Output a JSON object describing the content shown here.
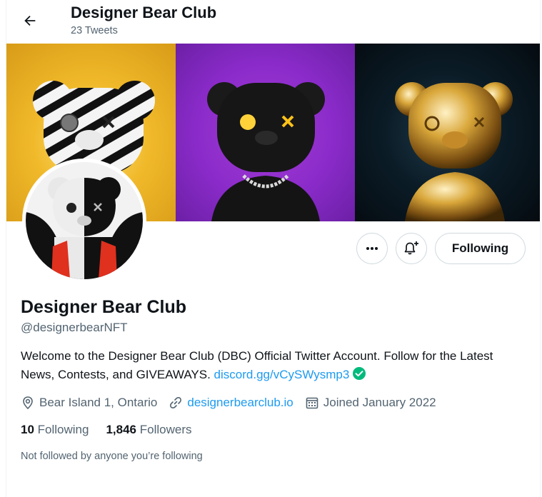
{
  "header": {
    "title": "Designer Bear Club",
    "subtitle": "23 Tweets"
  },
  "actions": {
    "following_label": "Following"
  },
  "profile": {
    "name": "Designer Bear Club",
    "handle": "@designerbearNFT",
    "bio_text": "Welcome to the Designer Bear Club (DBC) Official Twitter Account. Follow for the Latest News, Contests, and GIVEAWAYS.",
    "bio_link": "discord.gg/vCySWysmp3",
    "location": "Bear Island 1, Ontario",
    "website": "designerbearclub.io",
    "joined": "Joined January 2022",
    "following_count": "10",
    "following_label": "Following",
    "followers_count": "1,846",
    "followers_label": "Followers",
    "followed_by_note": "Not followed by anyone you’re following"
  },
  "colors": {
    "accent": "#1d9bf0",
    "verified": "#00ba7c",
    "text_primary": "#0f1419",
    "text_secondary": "#536471"
  },
  "icons": {
    "back": "arrow-left-icon",
    "more": "more-dots-icon",
    "notify": "bell-plus-icon",
    "location": "location-pin-icon",
    "website": "link-icon",
    "joined": "calendar-icon",
    "verified": "verified-check-icon"
  }
}
